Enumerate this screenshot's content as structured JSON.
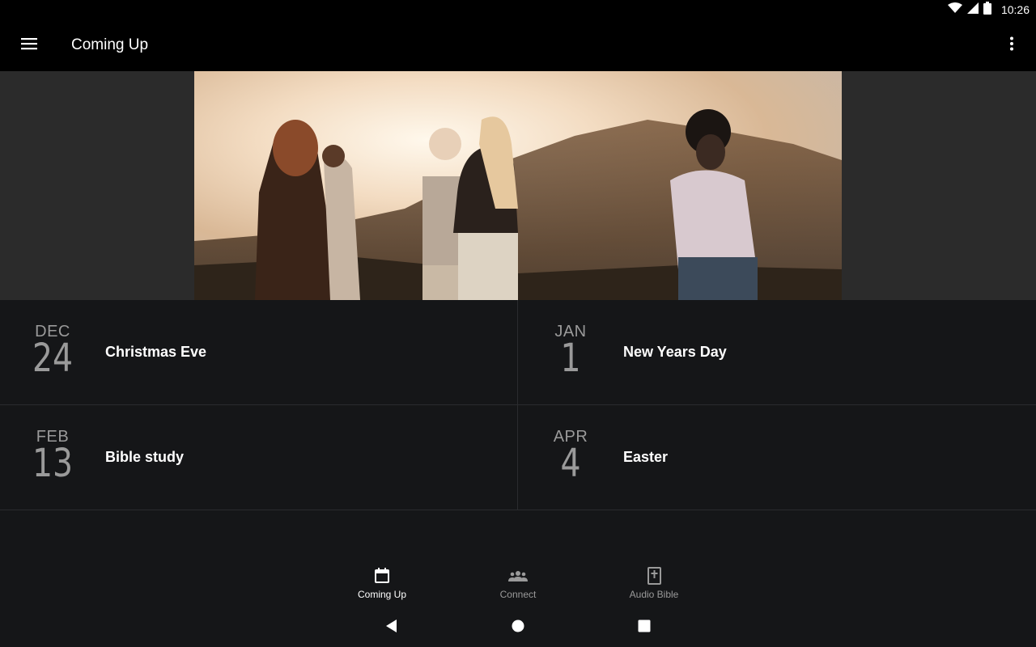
{
  "status_bar": {
    "time": "10:26",
    "icons": [
      "wifi-icon",
      "cell-signal-icon",
      "battery-icon"
    ]
  },
  "app_bar": {
    "title": "Coming Up",
    "menu_icon": "hamburger-menu-icon",
    "overflow_icon": "more-vert-icon"
  },
  "hero": {
    "image_description_icon": "photo-group-sunset"
  },
  "events": [
    {
      "month": "DEC",
      "day": "24",
      "title": "Christmas Eve"
    },
    {
      "month": "JAN",
      "day": "1",
      "title": "New Years Day"
    },
    {
      "month": "FEB",
      "day": "13",
      "title": "Bible study"
    },
    {
      "month": "APR",
      "day": "4",
      "title": "Easter"
    }
  ],
  "bottom_nav": {
    "items": [
      {
        "label": "Coming Up",
        "icon": "calendar-icon",
        "active": true
      },
      {
        "label": "Connect",
        "icon": "group-icon",
        "active": false
      },
      {
        "label": "Audio Bible",
        "icon": "bible-icon",
        "active": false
      }
    ]
  },
  "system_nav": {
    "icons": [
      "back-icon",
      "home-icon",
      "recents-icon"
    ]
  },
  "colors": {
    "app_bar": "#000000",
    "background": "#151618",
    "hero_surround": "#2b2b2b",
    "muted_text": "#9a9a9a",
    "divider": "#2a2b2e"
  }
}
